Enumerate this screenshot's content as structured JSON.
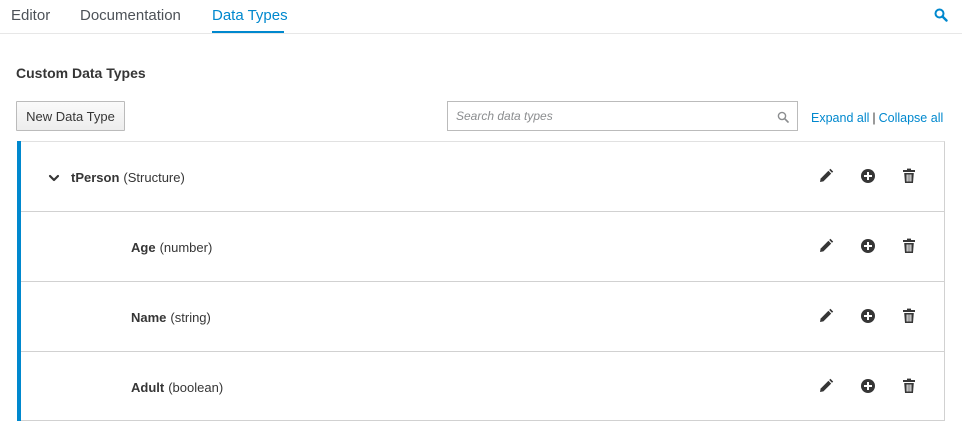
{
  "tabs": [
    {
      "label": "Editor",
      "active": false
    },
    {
      "label": "Documentation",
      "active": false
    },
    {
      "label": "Data Types",
      "active": true
    }
  ],
  "section_title": "Custom Data Types",
  "new_button_label": "New Data Type",
  "search": {
    "placeholder": "Search data types",
    "value": ""
  },
  "links": {
    "expand_all": "Expand all",
    "separator": "|",
    "collapse_all": "Collapse all"
  },
  "data_types": [
    {
      "name": "tPerson",
      "type": "(Structure)",
      "level": 0,
      "expanded": true
    },
    {
      "name": "Age",
      "type": "(number)",
      "level": 1
    },
    {
      "name": "Name",
      "type": "(string)",
      "level": 1
    },
    {
      "name": "Adult",
      "type": "(boolean)",
      "level": 1
    }
  ],
  "icons": {
    "edit": "pencil-icon",
    "add": "plus-circle-icon",
    "delete": "trash-icon",
    "search": "search-icon",
    "expand": "chevron-down-icon"
  },
  "colors": {
    "accent": "#0088ce",
    "text": "#363636",
    "border": "#d1d1d1"
  }
}
